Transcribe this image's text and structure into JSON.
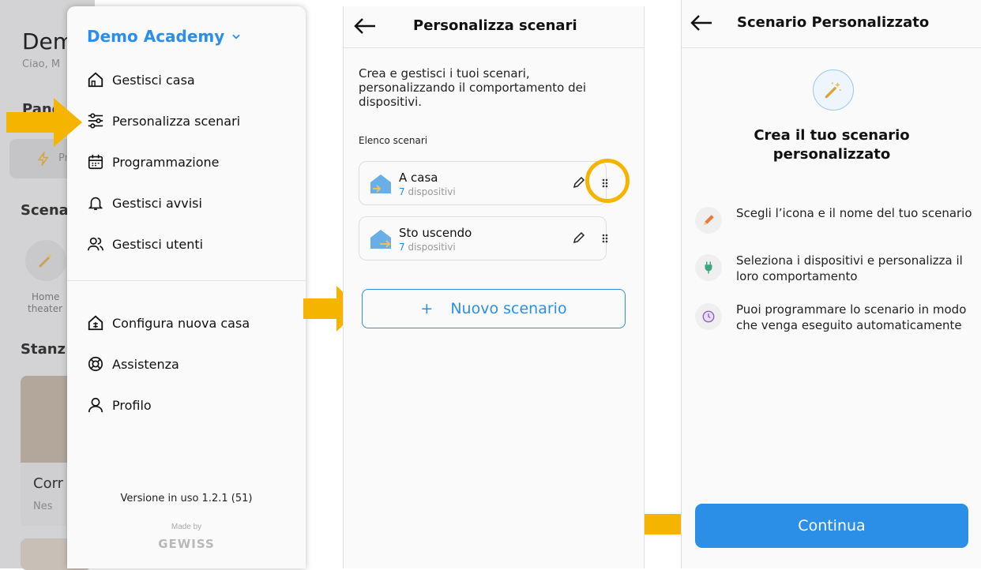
{
  "colors": {
    "accent": "#2b8fe8",
    "highlight": "#f5b400",
    "text": "#111111",
    "muted": "#999999"
  },
  "background_app": {
    "title_fragment": "Dem",
    "greeting_fragment": "Ciao, M",
    "section1_fragment": "Pano",
    "card_fragment": "Pr",
    "section2_fragment": "Scena",
    "scenario_label_line1": "Home",
    "scenario_label_line2": "theater",
    "section3_fragment": "Stanz",
    "room_fragment": "Corr",
    "room_status_fragment": "Nes"
  },
  "drawer": {
    "title": "Demo Academy",
    "items": [
      {
        "label": "Gestisci casa",
        "icon": "home-icon"
      },
      {
        "label": "Personalizza scenari",
        "icon": "sliders-icon"
      },
      {
        "label": "Programmazione",
        "icon": "calendar-icon"
      },
      {
        "label": "Gestisci avvisi",
        "icon": "bell-icon"
      },
      {
        "label": "Gestisci utenti",
        "icon": "users-icon"
      }
    ],
    "items2": [
      {
        "label": "Configura nuova casa",
        "icon": "house-config-icon"
      },
      {
        "label": "Assistenza",
        "icon": "lifebuoy-icon"
      },
      {
        "label": "Profilo",
        "icon": "user-icon"
      }
    ],
    "version": "Versione in uso 1.2.1 (51)",
    "made_by": "Made by",
    "brand": "GEWISS"
  },
  "scenari_screen": {
    "title": "Personalizza scenari",
    "intro": "Crea e gestisci i tuoi scenari, personalizzando il comportamento dei dispositivi.",
    "section_label": "Elenco scenari",
    "scenarios": [
      {
        "name": "A casa",
        "count": "7",
        "count_label": "dispositivi"
      },
      {
        "name": "Sto uscendo",
        "count": "7",
        "count_label": "dispositivi"
      }
    ],
    "new_button": "Nuovo scenario",
    "new_button_plus": "+"
  },
  "custom_screen": {
    "title": "Scenario Personalizzato",
    "heading_line1": "Crea il tuo scenario",
    "heading_line2": "personalizzato",
    "features": [
      {
        "text": "Scegli l’icona e il nome del tuo scenario",
        "icon": "pencil-icon"
      },
      {
        "text": "Seleziona i dispositivi e personalizza il loro comportamento",
        "icon": "plug-icon"
      },
      {
        "text": "Puoi programmare lo scenario in modo che venga eseguito automaticamente",
        "icon": "clock-icon"
      }
    ],
    "continue_button": "Continua"
  }
}
